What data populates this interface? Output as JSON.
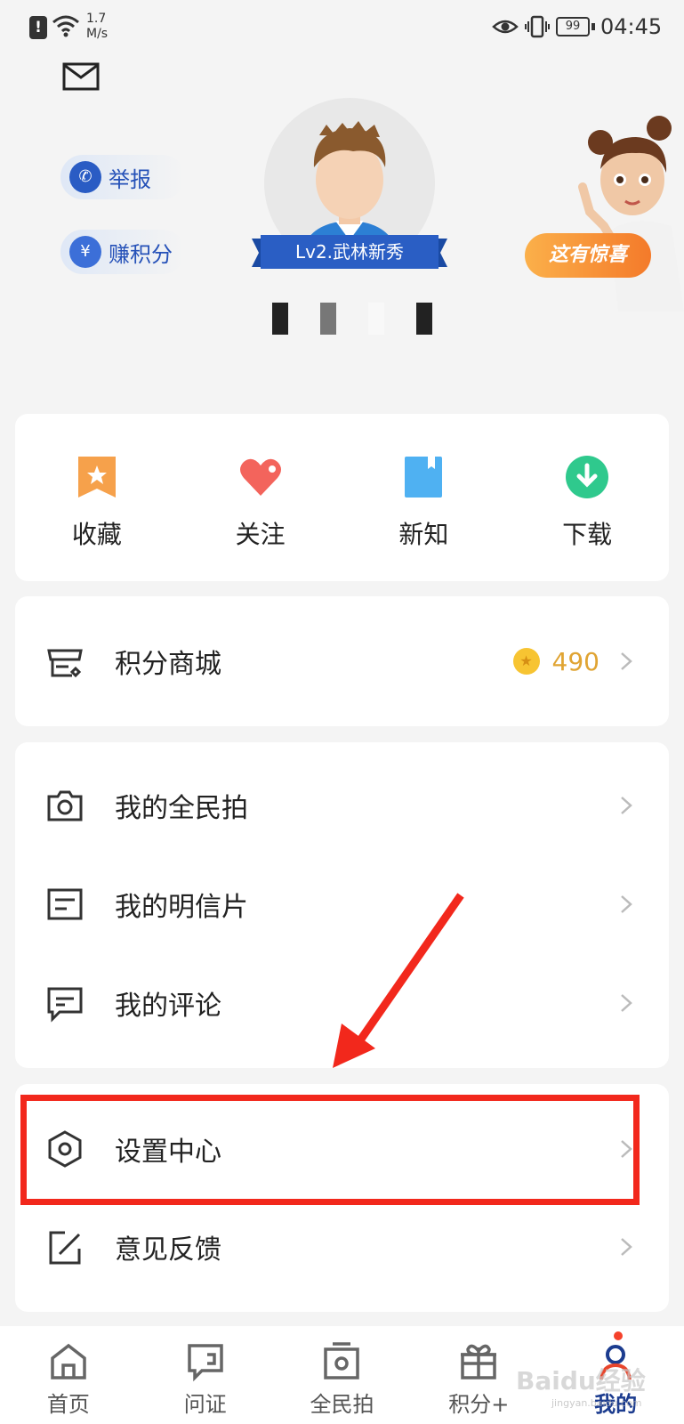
{
  "status_bar": {
    "alert": "!",
    "net_speed_value": "1.7",
    "net_speed_unit": "M/s",
    "battery": "99",
    "time": "04:45"
  },
  "profile": {
    "report_label": "举报",
    "earn_points_label": "赚积分",
    "level_label": "Lv2.武林新秀",
    "surprise_label": "这有惊喜"
  },
  "quick_actions": [
    {
      "label": "收藏",
      "icon": "bookmark-star-icon"
    },
    {
      "label": "关注",
      "icon": "heart-icon"
    },
    {
      "label": "新知",
      "icon": "book-icon"
    },
    {
      "label": "下载",
      "icon": "download-icon"
    }
  ],
  "points_mall": {
    "label": "积分商城",
    "value": "490"
  },
  "my_items": [
    {
      "label": "我的全民拍",
      "icon": "camera-icon"
    },
    {
      "label": "我的明信片",
      "icon": "postcard-icon"
    },
    {
      "label": "我的评论",
      "icon": "comment-icon"
    }
  ],
  "settings_items": [
    {
      "label": "设置中心",
      "icon": "settings-hexagon-icon"
    },
    {
      "label": "意见反馈",
      "icon": "feedback-edit-icon"
    }
  ],
  "tabs": [
    {
      "label": "首页",
      "icon": "home-icon"
    },
    {
      "label": "问证",
      "icon": "verify-icon"
    },
    {
      "label": "全民拍",
      "icon": "photo-frame-icon"
    },
    {
      "label": "积分+",
      "icon": "gift-icon"
    },
    {
      "label": "我的",
      "icon": "profile-icon"
    }
  ],
  "watermark": {
    "main": "Baidu经验",
    "sub": "jingyan.baidu.com"
  },
  "colors": {
    "accent_red": "#f2281c",
    "brand_blue": "#1c3c8f",
    "points_gold": "#e0a433"
  }
}
